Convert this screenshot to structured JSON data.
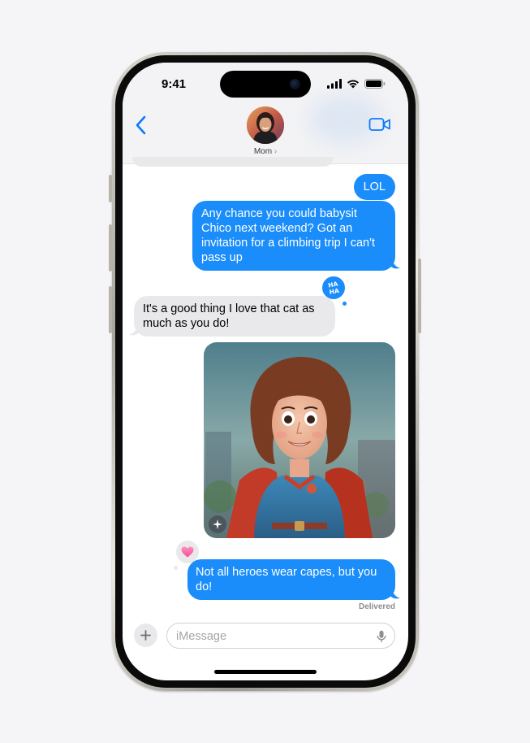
{
  "status_bar": {
    "time": "9:41"
  },
  "header": {
    "contact_name": "Mom",
    "contact_chevron": "›"
  },
  "messages": [
    {
      "side": "out",
      "text": "LOL"
    },
    {
      "side": "out",
      "text": "Any chance you could babysit Chico next weekend? Got an invitation for a climbing trip I can't pass up",
      "tapback": "haha-icon",
      "tapback_text": "HA HA"
    },
    {
      "side": "in",
      "text": "It's a good thing I love that cat as much as you do!"
    },
    {
      "side": "out",
      "type": "image",
      "image_desc": "superhero-mom-avatar-icon"
    },
    {
      "side": "out",
      "text": "Not all heroes wear capes, but you do!",
      "tapback": "heart-icon"
    }
  ],
  "delivered_label": "Delivered",
  "composer": {
    "placeholder": "iMessage"
  },
  "colors": {
    "bubble_out": "#1a8dfb",
    "bubble_in": "#e9e9eb",
    "accent": "#0a7aff"
  }
}
